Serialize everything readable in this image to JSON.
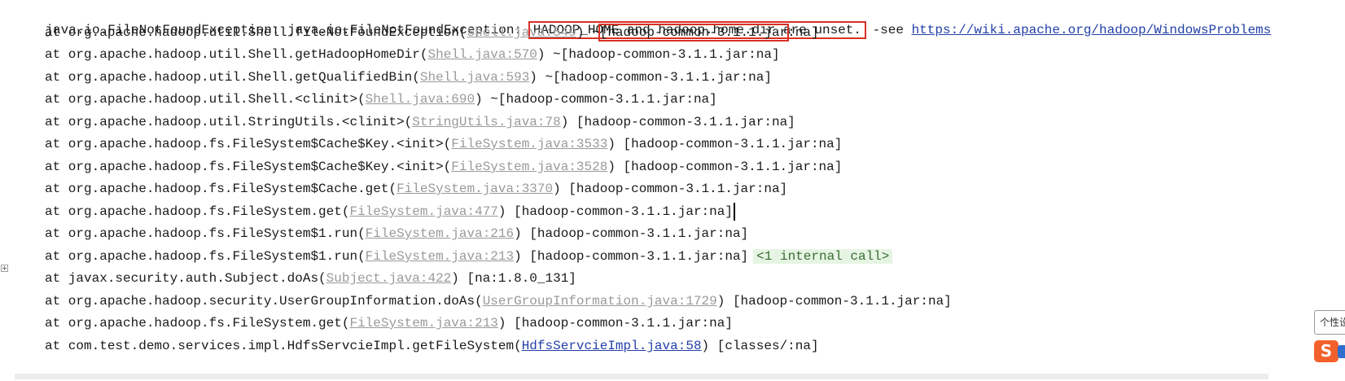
{
  "exception": {
    "prefix": "java.io.FileNotFoundException: java.io.FileNotFoundException: ",
    "message": "HADOOP_HOME and hadoop.home.dir are unset.",
    "see_text": " -see ",
    "url": "https://wiki.apache.org/hadoop/WindowsProblems"
  },
  "frames": [
    {
      "method": "at org.apache.hadoop.util.Shell.fileNotFoundException(",
      "file": "Shell.java:549",
      "after": ") ~",
      "jar": "[hadoop-common-3.1.1.jar",
      "jar_tail": ":na]"
    },
    {
      "method": "at org.apache.hadoop.util.Shell.getHadoopHomeDir(",
      "file": "Shell.java:570",
      "after": ") ~",
      "jar": "[hadoop-common-3.1.1.jar:na]"
    },
    {
      "method": "at org.apache.hadoop.util.Shell.getQualifiedBin(",
      "file": "Shell.java:593",
      "after": ") ~",
      "jar": "[hadoop-common-3.1.1.jar:na]"
    },
    {
      "method": "at org.apache.hadoop.util.Shell.<clinit>(",
      "file": "Shell.java:690",
      "after": ") ~",
      "jar": "[hadoop-common-3.1.1.jar:na]"
    },
    {
      "method": "at org.apache.hadoop.util.StringUtils.<clinit>(",
      "file": "StringUtils.java:78",
      "after": ") ",
      "jar": "[hadoop-common-3.1.1.jar:na]"
    },
    {
      "method": "at org.apache.hadoop.fs.FileSystem$Cache$Key.<init>(",
      "file": "FileSystem.java:3533",
      "after": ") ",
      "jar": "[hadoop-common-3.1.1.jar:na]"
    },
    {
      "method": "at org.apache.hadoop.fs.FileSystem$Cache$Key.<init>(",
      "file": "FileSystem.java:3528",
      "after": ") ",
      "jar": "[hadoop-common-3.1.1.jar:na]"
    },
    {
      "method": "at org.apache.hadoop.fs.FileSystem$Cache.get(",
      "file": "FileSystem.java:3370",
      "after": ") ",
      "jar": "[hadoop-common-3.1.1.jar:na]"
    },
    {
      "method": "at org.apache.hadoop.fs.FileSystem.get(",
      "file": "FileSystem.java:477",
      "after": ") ",
      "jar": "[hadoop-common-3.1.1.jar:na]"
    },
    {
      "method": "at org.apache.hadoop.fs.FileSystem$1.run(",
      "file": "FileSystem.java:216",
      "after": ") ",
      "jar": "[hadoop-common-3.1.1.jar:na]"
    },
    {
      "method": "at org.apache.hadoop.fs.FileSystem$1.run(",
      "file": "FileSystem.java:213",
      "after": ") ",
      "jar": "[hadoop-common-3.1.1.jar:na]",
      "internal": "<1 internal call>"
    },
    {
      "method": "at javax.security.auth.Subject.doAs(",
      "file": "Subject.java:422",
      "after": ") ",
      "jar": "[na:1.8.0_131]"
    },
    {
      "method": "at org.apache.hadoop.security.UserGroupInformation.doAs(",
      "file": "UserGroupInformation.java:1729",
      "after": ") ",
      "jar": "[hadoop-common-3.1.1.jar:na]"
    },
    {
      "method": "at org.apache.hadoop.fs.FileSystem.get(",
      "file": "FileSystem.java:213",
      "after": ") ",
      "jar": "[hadoop-common-3.1.1.jar:na]"
    },
    {
      "method": "at com.test.demo.services.impl.HdfsServcieImpl.getFileSystem(",
      "file": "HdfsServcieImpl.java:58",
      "after": ") ",
      "jar": "[classes/:na]"
    }
  ],
  "ime": {
    "tooltip": "个性设置",
    "logo": "S"
  },
  "colors": {
    "highlight_box": "#d93025",
    "library_link": "#9a9a9a",
    "project_link": "#2440a8",
    "internal_call_bg": "#e6f5e3"
  }
}
